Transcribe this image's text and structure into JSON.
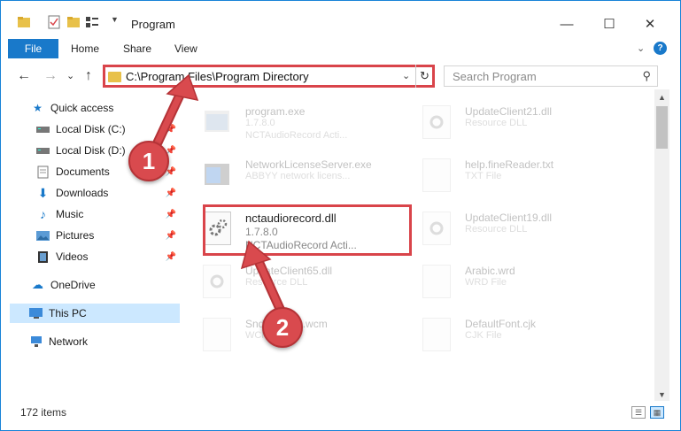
{
  "window": {
    "title": "Program",
    "minimize_glyph": "—",
    "maximize_glyph": "☐",
    "close_glyph": "✕"
  },
  "ribbon": {
    "file_tab": "File",
    "tabs": [
      "Home",
      "Share",
      "View"
    ],
    "expand_glyph": "⌄",
    "help_glyph": "?"
  },
  "address": {
    "path": "C:\\Program Files\\Program Directory",
    "search_placeholder": "Search Program",
    "back_glyph": "←",
    "forward_glyph": "→",
    "recent_glyph": "⌄",
    "up_glyph": "↑",
    "dropdown_glyph": "⌄",
    "refresh_glyph": "↻",
    "search_glyph": "⚲"
  },
  "nav": {
    "items": [
      {
        "label": "Quick access",
        "icon": "star-icon"
      },
      {
        "label": "Local Disk (C:)",
        "icon": "drive-icon"
      },
      {
        "label": "Local Disk (D:)",
        "icon": "drive-icon"
      },
      {
        "label": "Documents",
        "icon": "documents-icon"
      },
      {
        "label": "Downloads",
        "icon": "downloads-icon"
      },
      {
        "label": "Music",
        "icon": "music-icon"
      },
      {
        "label": "Pictures",
        "icon": "pictures-icon"
      },
      {
        "label": "Videos",
        "icon": "videos-icon"
      },
      {
        "label": "OneDrive",
        "icon": "cloud-icon"
      },
      {
        "label": "This PC",
        "icon": "computer-icon"
      },
      {
        "label": "Network",
        "icon": "network-icon"
      }
    ]
  },
  "files": [
    {
      "name": "program.exe",
      "line2": "1.7.8.0",
      "line3": "NCTAudioRecord Acti..."
    },
    {
      "name": "UpdateClient21.dll",
      "line2": "Resource DLL",
      "line3": ""
    },
    {
      "name": "NetworkLicenseServer.exe",
      "line2": "ABBYY network licens...",
      "line3": ""
    },
    {
      "name": "help.fineReader.txt",
      "line2": "TXT File",
      "line3": ""
    },
    {
      "name": "nctaudiorecord.dll",
      "line2": "1.7.8.0",
      "line3": "NCTAudioRecord Acti..."
    },
    {
      "name": "UpdateClient19.dll",
      "line2": "Resource DLL",
      "line3": ""
    },
    {
      "name": "UpdateClient65.dll",
      "line2": "Resource DLL",
      "line3": ""
    },
    {
      "name": "Arabic.wrd",
      "line2": "WRD File",
      "line3": ""
    },
    {
      "name": "Snd2Text(0).wcm",
      "line2": "WCM File",
      "line3": ""
    },
    {
      "name": "DefaultFont.cjk",
      "line2": "CJK File",
      "line3": ""
    }
  ],
  "status": {
    "item_count": "172 items"
  },
  "steps": [
    "1",
    "2"
  ],
  "colors": {
    "accent": "#1979ca",
    "highlight": "#d9444a",
    "selected": "#cce8ff"
  }
}
